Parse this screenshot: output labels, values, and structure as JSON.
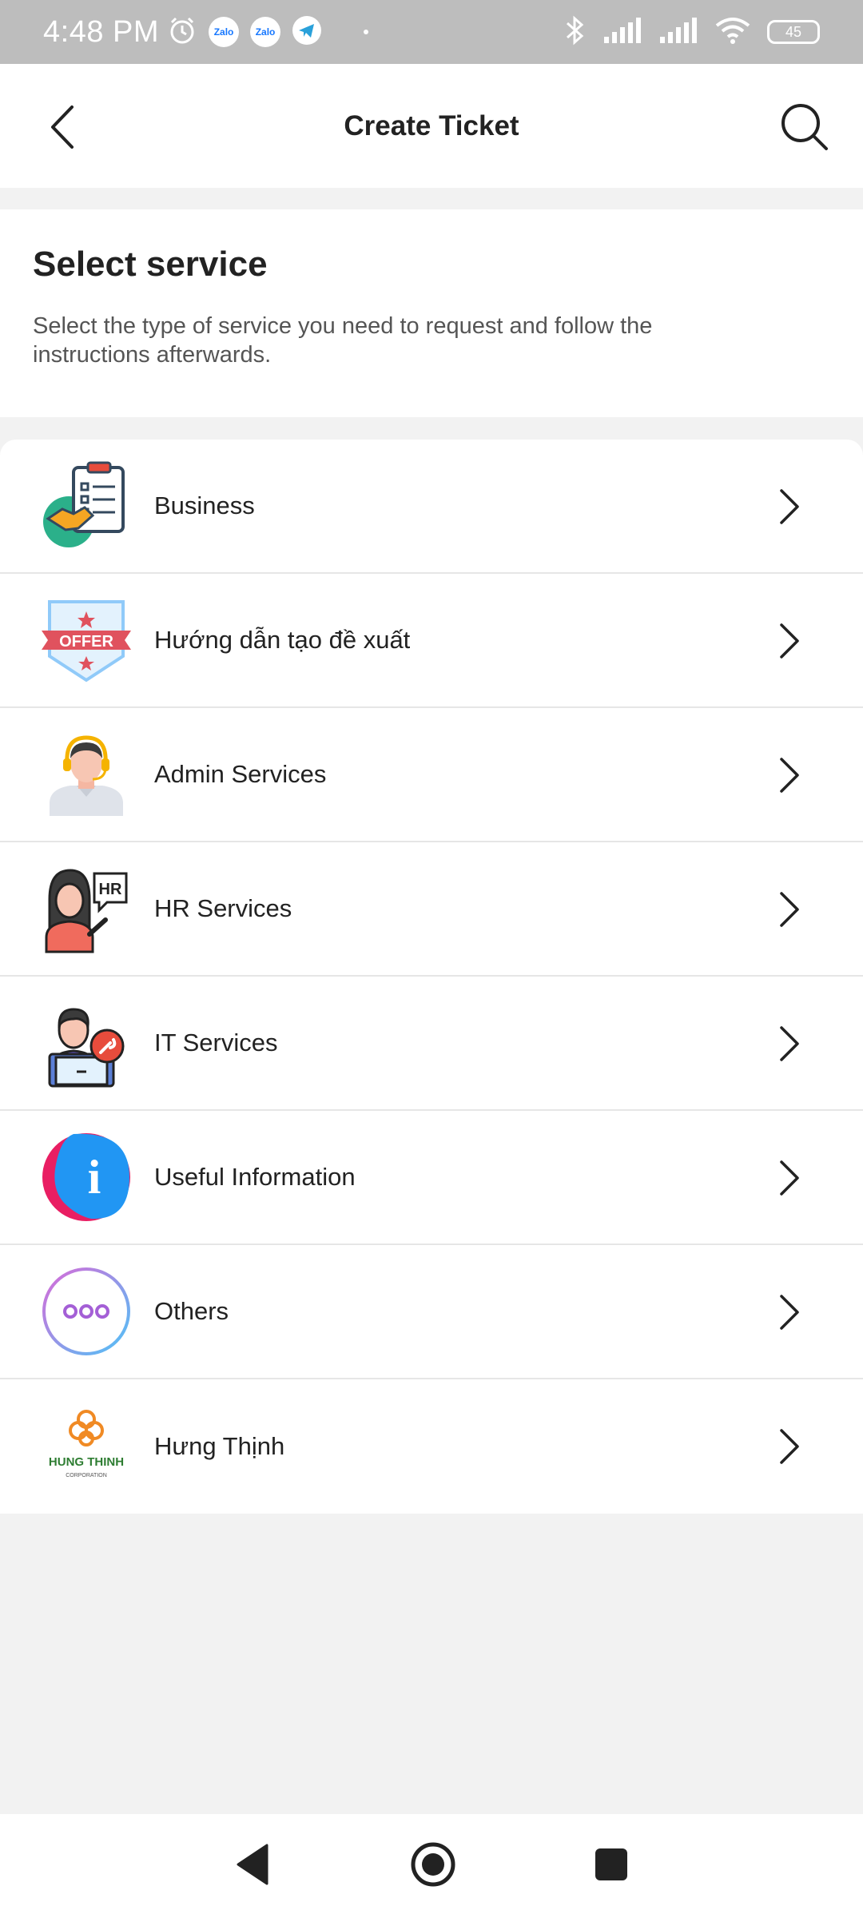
{
  "status_bar": {
    "time": "4:48 PM",
    "notification_icons": [
      "alarm-icon",
      "zalo-icon",
      "zalo-icon",
      "telegram-icon"
    ],
    "zalo_text": "Zalo",
    "battery": "45"
  },
  "header": {
    "title": "Create Ticket"
  },
  "intro": {
    "title": "Select service",
    "description": "Select the type of service you need to request and follow the instructions afterwards."
  },
  "services": [
    {
      "label": "Business",
      "icon": "business-handshake-icon"
    },
    {
      "label": "Hướng dẫn tạo đề xuất",
      "icon": "offer-badge-icon",
      "icon_text": "OFFER"
    },
    {
      "label": "Admin Services",
      "icon": "admin-support-icon"
    },
    {
      "label": "HR Services",
      "icon": "hr-person-icon",
      "icon_text": "HR"
    },
    {
      "label": "IT Services",
      "icon": "it-support-icon"
    },
    {
      "label": "Useful Information",
      "icon": "info-icon",
      "icon_text": "i"
    },
    {
      "label": "Others",
      "icon": "more-dots-icon"
    },
    {
      "label": "Hưng Thịnh",
      "icon": "hung-thinh-logo",
      "icon_text": "HUNG THINH",
      "icon_subtext": "CORPORATION"
    }
  ],
  "colors": {
    "header_bg": "#ffffff",
    "page_bg": "#f2f2f2",
    "status_bar_bg": "#bdbdbd",
    "text_primary": "#222222",
    "text_secondary": "#555555"
  }
}
